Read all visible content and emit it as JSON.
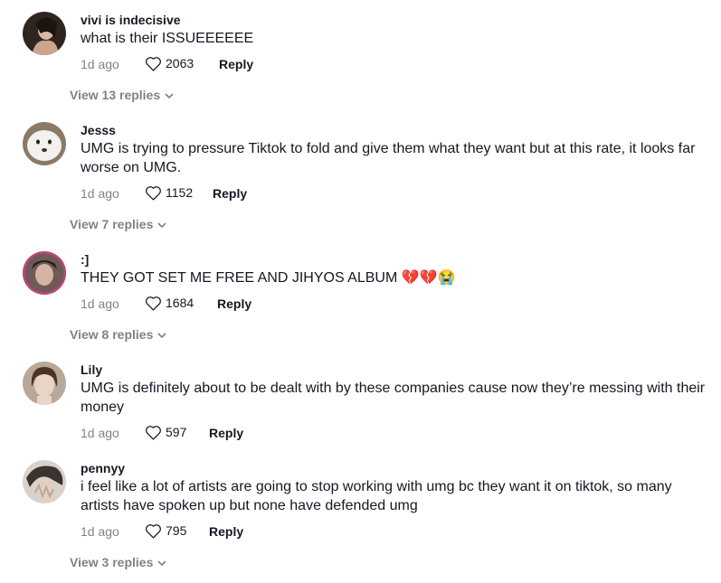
{
  "comments": [
    {
      "username": "vivi is indecisive",
      "text": "what is their ISSUEEEEEE",
      "time": "1d ago",
      "likes": "2063",
      "reply_label": "Reply",
      "view_replies": "View 13 replies",
      "avatar_colors": [
        "#3a2a22",
        "#d9b9a3"
      ]
    },
    {
      "username": "Jesss",
      "text": "UMG is trying to pressure Tiktok to fold and give them what they want but at this rate, it looks far worse on UMG.",
      "time": "1d ago",
      "likes": "1152",
      "reply_label": "Reply",
      "view_replies": "View 7 replies",
      "avatar_colors": [
        "#8a7a66",
        "#f3f1ee"
      ]
    },
    {
      "username": ":]",
      "text": "THEY GOT SET ME FREE AND JIHYOS ALBUM 💔💔😭",
      "time": "1d ago",
      "likes": "1684",
      "reply_label": "Reply",
      "view_replies": "View 8 replies",
      "avatar_colors": [
        "#c0447a",
        "#6f5a58"
      ]
    },
    {
      "username": "Lily",
      "text": "UMG is definitely about to be dealt with by these companies cause now they’re messing with their money",
      "time": "1d ago",
      "likes": "597",
      "reply_label": "Reply",
      "view_replies": "",
      "avatar_colors": [
        "#b8a89a",
        "#e9d4c6"
      ]
    },
    {
      "username": "pennyy",
      "text": "i feel like a lot of artists are going to stop working with umg bc they want it on tiktok, so many artists have spoken up but none have defended umg",
      "time": "1d ago",
      "likes": "795",
      "reply_label": "Reply",
      "view_replies": "View 3 replies",
      "avatar_colors": [
        "#d8d2cc",
        "#3a3330"
      ]
    }
  ]
}
